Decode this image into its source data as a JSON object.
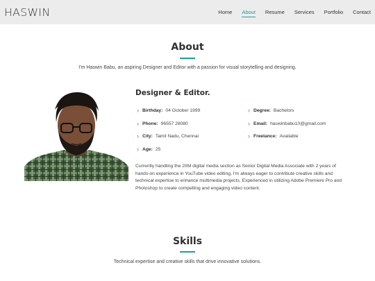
{
  "header": {
    "logo": "HASWIN",
    "nav": [
      "Home",
      "About",
      "Resume",
      "Services",
      "Portfolio",
      "Contact"
    ],
    "active": "About"
  },
  "about": {
    "title": "About",
    "intro": "I'm Haswin Babu, an aspiring Designer and Editor with a passion for visual storytelling and designing.",
    "role": "Designer & Editor.",
    "details_left": [
      {
        "key": "Birthday:",
        "value": "04 October 1999"
      },
      {
        "key": "Phone:",
        "value": "96557 28080"
      },
      {
        "key": "City:",
        "value": "Tamil Nadu, Chennai"
      },
      {
        "key": "Age:",
        "value": "25"
      }
    ],
    "details_right": [
      {
        "key": "Degree:",
        "value": "Bachelors"
      },
      {
        "key": "Email:",
        "value": "haswinbabu10@gmail.com"
      },
      {
        "key": "Freelance:",
        "value": "Available"
      }
    ],
    "description": "Currently handling the 2IIM digital media section as Senior Digital Media Associate with 2 years of hands-on experience in YouTube video editing, I'm always eager to contribute creative skills and technical expertise to enhance multimedia projects. Experienced in utilizing Adobe Premiere Pro and Photoshop to create compelling and engaging video content."
  },
  "skills": {
    "title": "Skills",
    "intro": "Technical expertise and creative skills that drive innovative solutions."
  },
  "colors": {
    "accent": "#1b9ea0",
    "header_bg": "#ececec",
    "heading": "#2f2f2f",
    "text": "#444444"
  },
  "icons": {
    "bullet": "chevron-right-icon"
  }
}
